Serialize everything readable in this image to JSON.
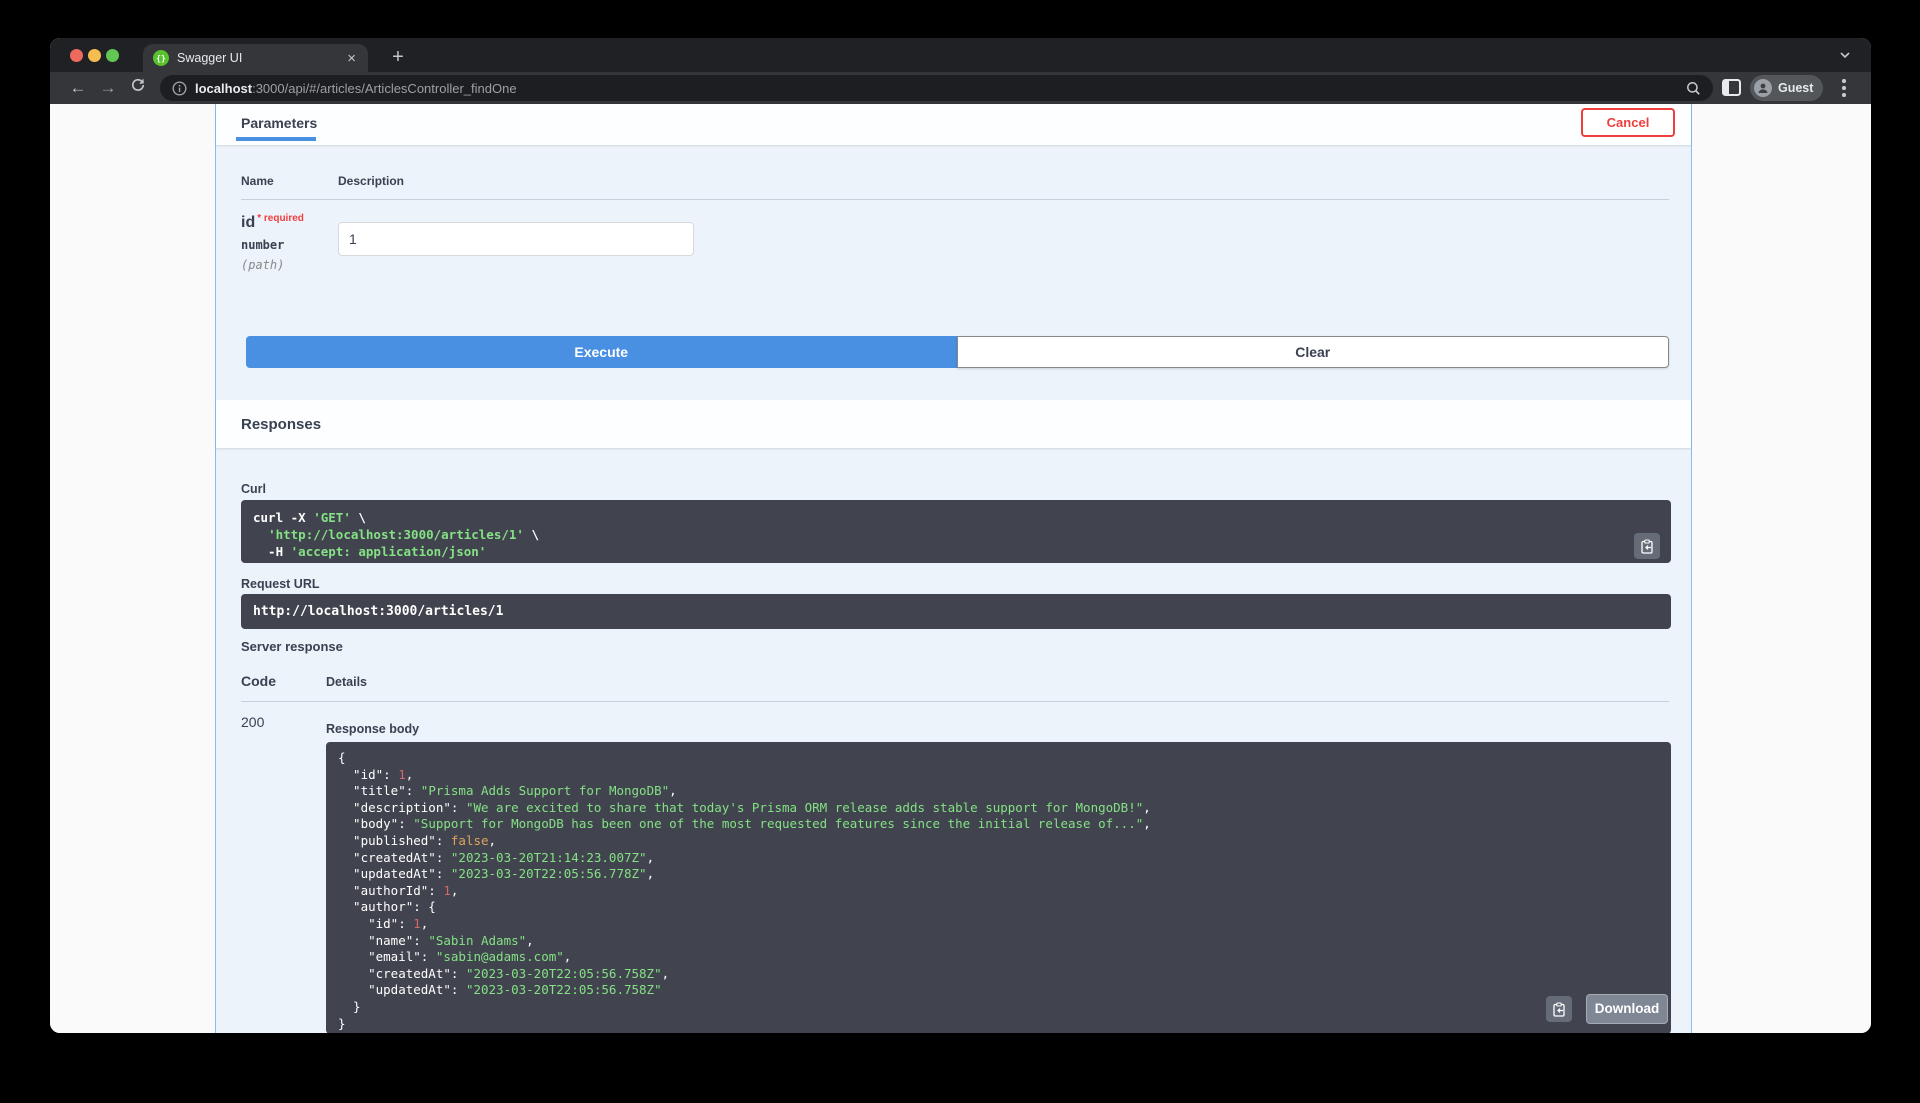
{
  "browser": {
    "tab_title": "Swagger UI",
    "new_tab_label": "+",
    "close_tab_label": "×",
    "url_host": "localhost",
    "url_rest": ":3000/api/#/articles/ArticlesController_findOne",
    "back_label": "←",
    "forward_label": "→",
    "profile_label": "Guest"
  },
  "parameters_section": {
    "title": "Parameters",
    "cancel_label": "Cancel",
    "name_header": "Name",
    "description_header": "Description",
    "param": {
      "name": "id",
      "required": "* required",
      "type": "number",
      "location": "(path)",
      "value": "1"
    }
  },
  "actions": {
    "execute_label": "Execute",
    "clear_label": "Clear"
  },
  "responses_section": {
    "title": "Responses",
    "curl_label": "Curl",
    "curl_lines": [
      [
        [
          "p",
          "curl -X "
        ],
        [
          "s",
          "'GET'"
        ],
        [
          "p",
          " \\"
        ]
      ],
      [
        [
          "p",
          "  "
        ],
        [
          "s",
          "'http://localhost:3000/articles/1'"
        ],
        [
          "p",
          " \\"
        ]
      ],
      [
        [
          "p",
          "  -H "
        ],
        [
          "s",
          "'accept: application/json'"
        ]
      ]
    ],
    "request_url_label": "Request URL",
    "request_url": "http://localhost:3000/articles/1",
    "server_response_label": "Server response",
    "code_header": "Code",
    "details_header": "Details",
    "status_code": "200",
    "response_body_label": "Response body",
    "response_lines": [
      [
        [
          "p",
          "{"
        ]
      ],
      [
        [
          "p",
          "  \"id\": "
        ],
        [
          "n",
          "1"
        ],
        [
          "p",
          ","
        ]
      ],
      [
        [
          "p",
          "  \"title\": "
        ],
        [
          "s",
          "\"Prisma Adds Support for MongoDB\""
        ],
        [
          "p",
          ","
        ]
      ],
      [
        [
          "p",
          "  \"description\": "
        ],
        [
          "s",
          "\"We are excited to share that today's Prisma ORM release adds stable support for MongoDB!\""
        ],
        [
          "p",
          ","
        ]
      ],
      [
        [
          "p",
          "  \"body\": "
        ],
        [
          "s",
          "\"Support for MongoDB has been one of the most requested features since the initial release of...\""
        ],
        [
          "p",
          ","
        ]
      ],
      [
        [
          "p",
          "  \"published\": "
        ],
        [
          "b",
          "false"
        ],
        [
          "p",
          ","
        ]
      ],
      [
        [
          "p",
          "  \"createdAt\": "
        ],
        [
          "s",
          "\"2023-03-20T21:14:23.007Z\""
        ],
        [
          "p",
          ","
        ]
      ],
      [
        [
          "p",
          "  \"updatedAt\": "
        ],
        [
          "s",
          "\"2023-03-20T22:05:56.778Z\""
        ],
        [
          "p",
          ","
        ]
      ],
      [
        [
          "p",
          "  \"authorId\": "
        ],
        [
          "n",
          "1"
        ],
        [
          "p",
          ","
        ]
      ],
      [
        [
          "p",
          "  \"author\": {"
        ]
      ],
      [
        [
          "p",
          "    \"id\": "
        ],
        [
          "n",
          "1"
        ],
        [
          "p",
          ","
        ]
      ],
      [
        [
          "p",
          "    \"name\": "
        ],
        [
          "s",
          "\"Sabin Adams\""
        ],
        [
          "p",
          ","
        ]
      ],
      [
        [
          "p",
          "    \"email\": "
        ],
        [
          "s",
          "\"sabin@adams.com\""
        ],
        [
          "p",
          ","
        ]
      ],
      [
        [
          "p",
          "    \"createdAt\": "
        ],
        [
          "s",
          "\"2023-03-20T22:05:56.758Z\""
        ],
        [
          "p",
          ","
        ]
      ],
      [
        [
          "p",
          "    \"updatedAt\": "
        ],
        [
          "s",
          "\"2023-03-20T22:05:56.758Z\""
        ]
      ],
      [
        [
          "p",
          "  }"
        ]
      ],
      [
        [
          "p",
          "}"
        ]
      ]
    ],
    "download_label": "Download"
  },
  "colors": {
    "accent_blue": "#4990e2",
    "cancel_red": "#f03e3e",
    "opblock_border_blue": "#89bcf3",
    "code_background": "#41444e",
    "string_green": "#84e184",
    "number_red": "#d36666",
    "boolean_orange": "#dfa35e"
  }
}
